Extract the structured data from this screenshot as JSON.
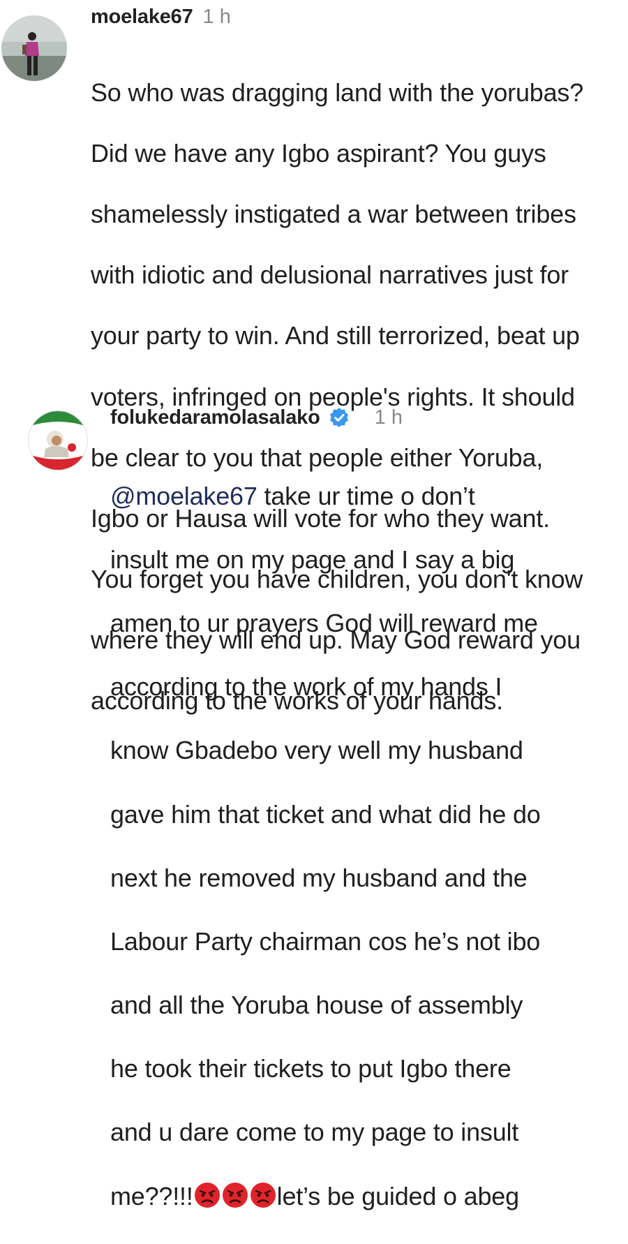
{
  "comments": [
    {
      "username": "moelake67",
      "time": "1 h",
      "avatar_icon": "user-photo-avatar",
      "lines": [
        "So who was dragging land with the yorubas?",
        "Did we have any Igbo aspirant? You guys",
        "shamelessly instigated a war between tribes",
        "with idiotic and delusional narratives just for",
        "your party to win. And still terrorized, beat up",
        "voters, infringed on people's rights. It should",
        "be clear to you that people either Yoruba,",
        "Igbo or Hausa will vote for who they want.",
        "You forget you have children, you don't know",
        "where they will end up. May God reward you",
        "according to the works of your hands."
      ]
    },
    {
      "username": "folukedaramolasalako",
      "time": "1 h",
      "verified": true,
      "avatar_icon": "profile-photo-avatar",
      "mention": "@moelake67",
      "first_line_rest": " take ur time o don’t",
      "lines": [
        "insult me on my page and I say a big",
        "amen to ur prayers God will reward me",
        "according to the work of my hands I",
        "know Gbadebo very well my husband",
        "gave him that ticket and what did he do",
        "next he removed my husband and the",
        "Labour Party chairman cos he’s not ibo",
        "and all the Yoruba house of assembly",
        "he took their tickets to put Igbo there",
        "and u dare come to my page to insult"
      ],
      "last_line_prefix": "me??!!!",
      "last_line_emojis": [
        "angry-face-emoji",
        "angry-face-emoji",
        "angry-face-emoji"
      ],
      "last_line_suffix": "let’s be guided o abeg"
    }
  ],
  "colors": {
    "username": "#222222",
    "time": "#888888",
    "verified_badge": "#3897f0",
    "emoji_red": "#e0242b"
  }
}
